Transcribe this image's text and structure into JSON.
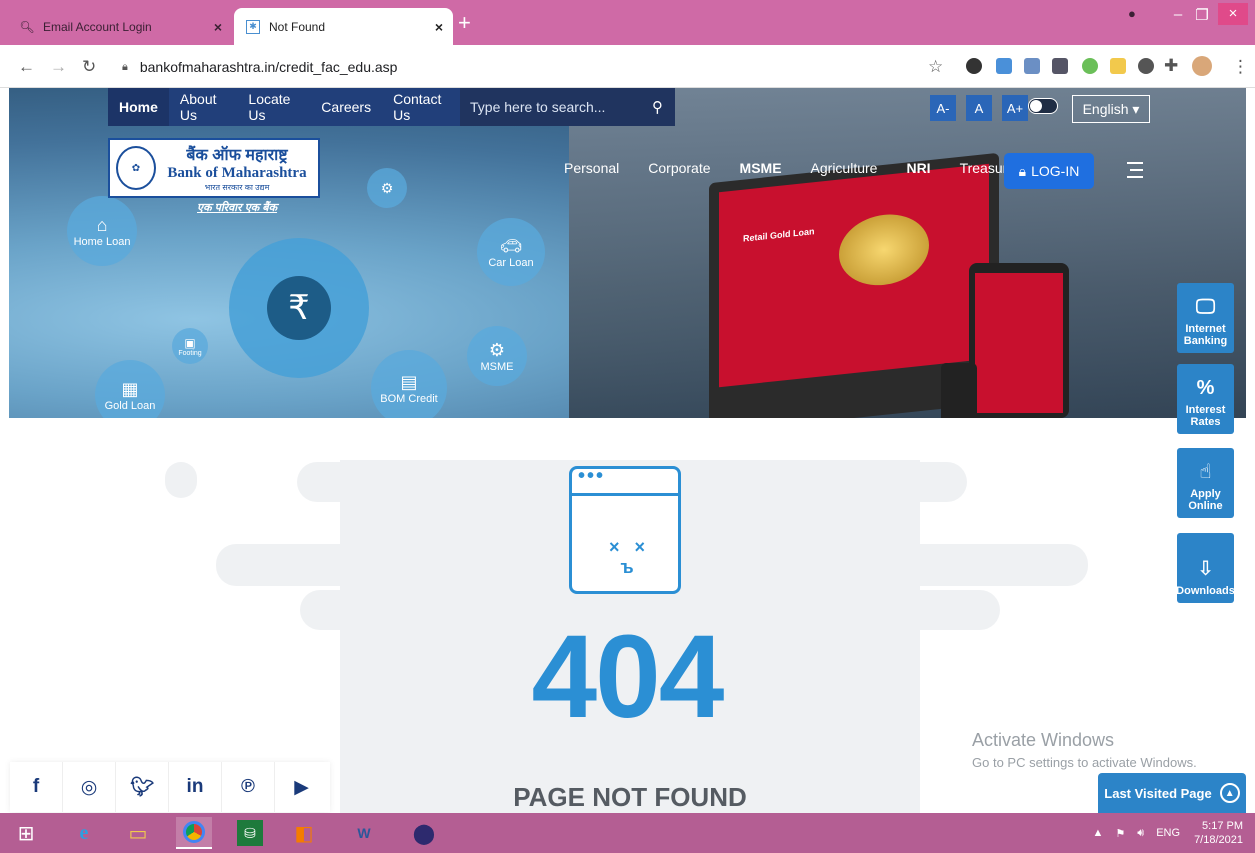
{
  "browser": {
    "tabs": [
      {
        "title": "Email Account Login",
        "favicon": "search-icon"
      },
      {
        "title": "Not Found",
        "favicon": "page-icon",
        "active": true
      }
    ],
    "new_tab": "+",
    "url": "bankofmaharashtra.in/credit_fac_edu.asp"
  },
  "site": {
    "top_nav": [
      "Home",
      "About Us",
      "Locate Us",
      "Careers",
      "Contact Us"
    ],
    "search_placeholder": "Type here to search...",
    "font_buttons": [
      "A-",
      "A",
      "A+"
    ],
    "language": "English ▾",
    "logo": {
      "hindi": "बैंक ऑफ महाराष्ट्र",
      "english": "Bank of Maharashtra",
      "sub": "भारत सरकार का उद्यम",
      "tagline": "एक परिवार एक बैंक"
    },
    "main_nav": [
      "Personal",
      "Corporate",
      "MSME",
      "Agriculture",
      "NRI",
      "Treasury"
    ],
    "login_label": "LOG-IN",
    "hero_nodes": [
      "Home Loan",
      "Car Loan",
      "Gold Loan",
      "Footing",
      "BOM Credit",
      "MSME"
    ],
    "hero_screen_title": "Retail Gold Loan",
    "side_links": [
      {
        "label": "Internet Banking",
        "icon": "monitor-icon"
      },
      {
        "label": "Interest Rates",
        "icon": "percent-icon"
      },
      {
        "label": "Apply Online",
        "icon": "hand-tap-icon"
      },
      {
        "label": "Downloads",
        "icon": "download-file-icon"
      }
    ],
    "error_code": "404",
    "error_text": "PAGE NOT FOUND",
    "social": [
      "facebook-icon",
      "instagram-icon",
      "twitter-icon",
      "linkedin-icon",
      "pinterest-icon",
      "youtube-icon"
    ],
    "last_visited": "Last Visited Page"
  },
  "watermark": {
    "line1": "Activate Windows",
    "line2": "Go to PC settings to activate Windows."
  },
  "taskbar": {
    "lang": "ENG",
    "time": "5:17 PM",
    "date": "7/18/2021"
  },
  "colors": {
    "accent": "#2b8fd4",
    "tab_strip": "#cf6aa6",
    "taskbar": "#b45e93",
    "nav_bar": "#213f7a"
  }
}
